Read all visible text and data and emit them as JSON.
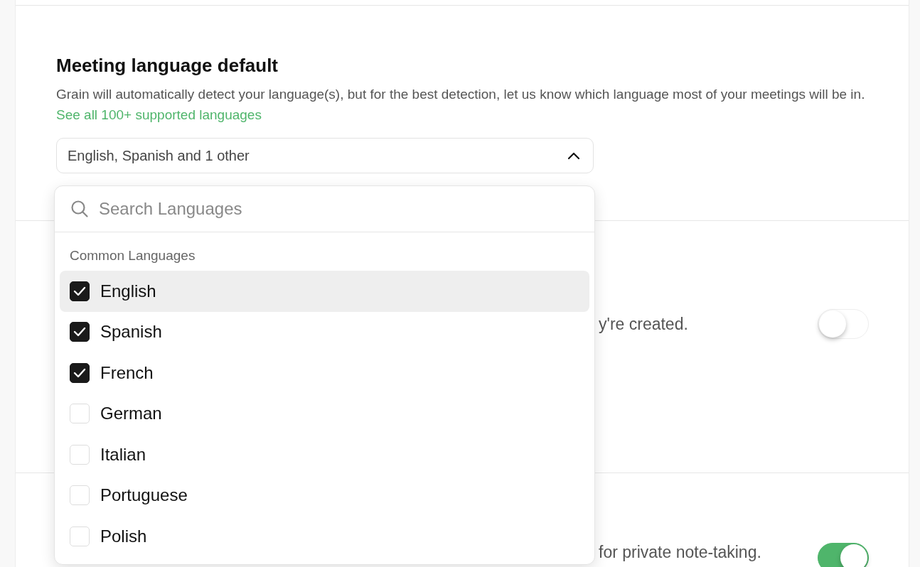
{
  "section": {
    "title": "Meeting language default",
    "description": "Grain will automatically detect your language(s), but for the best detection, let us know which language most of your meetings will be in.",
    "link": "See all 100+ supported languages"
  },
  "language_select": {
    "value": "English, Spanish and 1 other",
    "expanded": true,
    "search": {
      "placeholder": "Search Languages"
    },
    "group_label": "Common Languages",
    "options": [
      {
        "label": "English",
        "checked": true,
        "highlighted": true
      },
      {
        "label": "Spanish",
        "checked": true,
        "highlighted": false
      },
      {
        "label": "French",
        "checked": true,
        "highlighted": false
      },
      {
        "label": "German",
        "checked": false,
        "highlighted": false
      },
      {
        "label": "Italian",
        "checked": false,
        "highlighted": false
      },
      {
        "label": "Portuguese",
        "checked": false,
        "highlighted": false
      },
      {
        "label": "Polish",
        "checked": false,
        "highlighted": false
      }
    ]
  },
  "other_settings": [
    {
      "description": "y're created.",
      "on": false
    },
    {
      "description": "for private note-taking.",
      "on": true
    }
  ]
}
